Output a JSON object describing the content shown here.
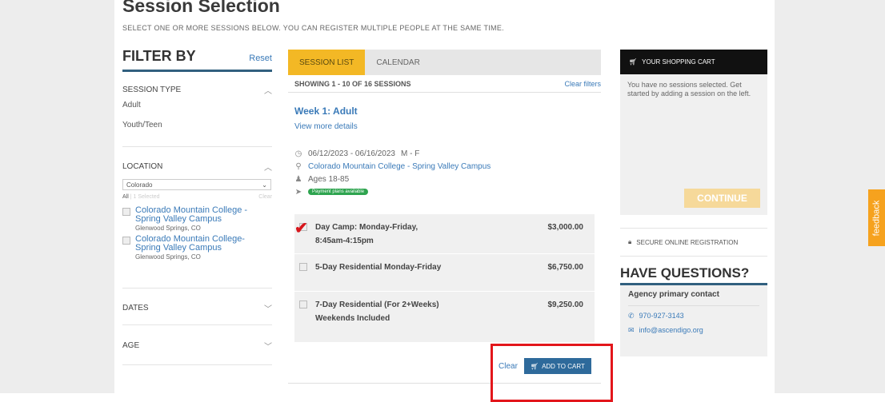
{
  "page": {
    "title": "Session Selection",
    "subtitle": "SELECT ONE OR MORE SESSIONS BELOW. YOU CAN REGISTER MULTIPLE PEOPLE AT THE SAME TIME."
  },
  "filter": {
    "title": "FILTER BY",
    "reset_label": "Reset",
    "session_type": {
      "label": "SESSION TYPE",
      "options": [
        "Adult",
        "Youth/Teen"
      ]
    },
    "location": {
      "label": "LOCATION",
      "selected": "Colorado",
      "all_label": "All",
      "selected_count": "1 Selected",
      "clear_label": "Clear",
      "items": [
        {
          "name": "Colorado Mountain College - Spring Valley Campus",
          "city": "Glenwood Springs, CO"
        },
        {
          "name": "Colorado Mountain College- Spring Valley Campus",
          "city": "Glenwood Springs, CO"
        }
      ]
    },
    "dates_label": "DATES",
    "age_label": "AGE"
  },
  "sessions": {
    "tabs": [
      "SESSION LIST",
      "CALENDAR"
    ],
    "showing": "SHOWING 1 - 10 OF 16 SESSIONS",
    "clear_filters": "Clear filters",
    "week_title": "Week 1: Adult",
    "more_details": "View more details",
    "dates": "06/12/2023 - 06/16/2023",
    "days": "M - F",
    "location": "Colorado Mountain College - Spring Valley Campus",
    "ages": "Ages 18-85",
    "badge": "Payment plans available",
    "options": [
      {
        "name": "Day Camp: Monday-Friday, 8:45am-4:15pm",
        "price": "$3,000.00"
      },
      {
        "name": "5-Day Residential Monday-Friday",
        "price": "$6,750.00"
      },
      {
        "name": "7-Day Residential (For 2+Weeks) Weekends Included",
        "price": "$9,250.00"
      }
    ],
    "clear_label": "Clear",
    "add_to_cart": "ADD TO CART"
  },
  "cart": {
    "title": "YOUR SHOPPING CART",
    "empty_text": "You have no sessions selected. Get started by adding a session on the left.",
    "continue_label": "CONTINUE",
    "secure_label": "SECURE ONLINE REGISTRATION",
    "questions_title": "HAVE QUESTIONS?",
    "agency_contact": "Agency primary contact",
    "phone": "970-927-3143",
    "email": "info@ascendigo.org"
  },
  "feedback_label": "feedback",
  "colors": {
    "accent": "#f3b825",
    "link": "#3a7ab8",
    "annotation": "#e3161b",
    "badge": "#2ea44f"
  }
}
